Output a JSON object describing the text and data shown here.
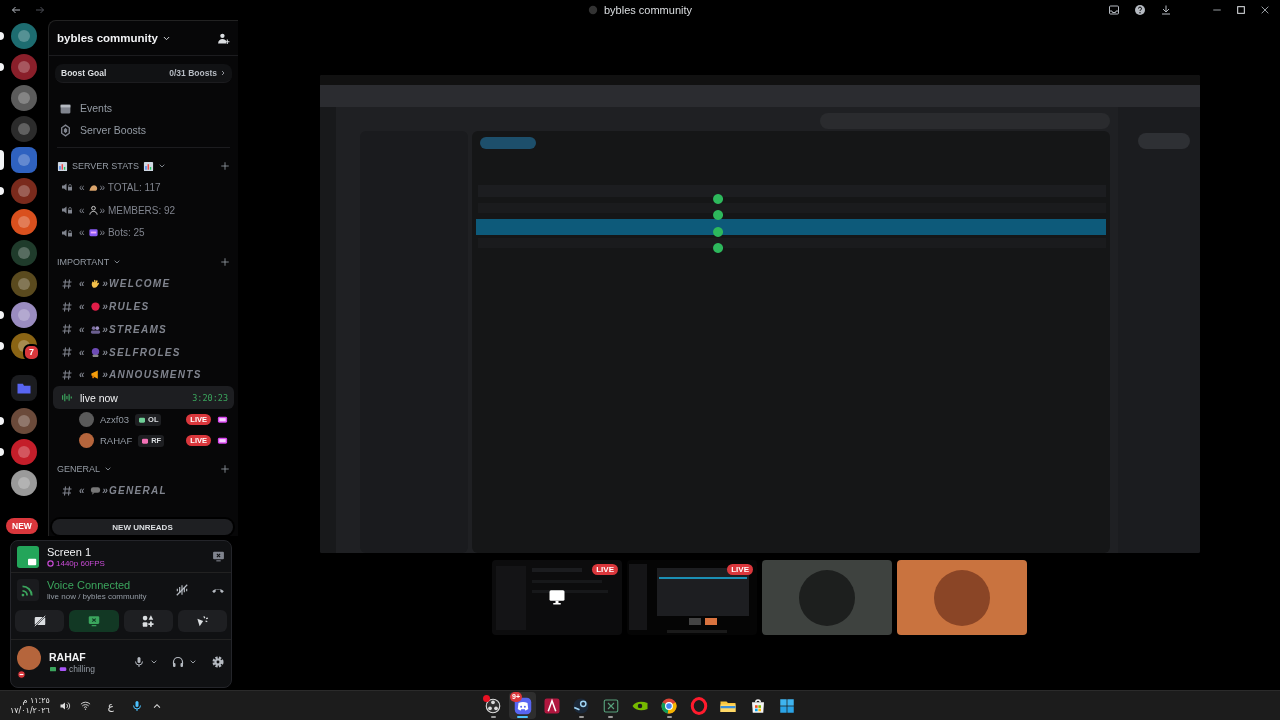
{
  "titlebar": {
    "title": "bybles community"
  },
  "servers": [
    {
      "kind": "server",
      "color": "#1d6c70",
      "unread": true,
      "selected": false
    },
    {
      "kind": "server",
      "color": "#8a1f2a",
      "unread": true,
      "selected": false
    },
    {
      "kind": "server",
      "color": "#5b5b5b",
      "unread": false,
      "selected": false
    },
    {
      "kind": "server",
      "color": "#2b2b2b",
      "unread": false,
      "selected": false
    },
    {
      "kind": "server",
      "color": "#2f62c0",
      "unread": false,
      "selected": true
    },
    {
      "kind": "server",
      "color": "#7a2a1c",
      "unread": true,
      "selected": false
    },
    {
      "kind": "server",
      "color": "#d9501e",
      "unread": false,
      "selected": false
    },
    {
      "kind": "server",
      "color": "#1f3b2b",
      "unread": false,
      "selected": false
    },
    {
      "kind": "server",
      "color": "#5a4a1e",
      "unread": false,
      "selected": false
    },
    {
      "kind": "server",
      "color": "#9a8cc0",
      "unread": true,
      "selected": false
    },
    {
      "kind": "server",
      "color": "#8a6414",
      "unread": true,
      "selected": false,
      "badge": "7"
    },
    {
      "kind": "folder",
      "color": "#5865f2",
      "unread": false,
      "selected": false
    },
    {
      "kind": "server",
      "color": "#6b4a3a",
      "unread": true,
      "selected": false
    },
    {
      "kind": "server",
      "color": "#c41e2a",
      "unread": true,
      "selected": false
    },
    {
      "kind": "server",
      "color": "#9a9a9a",
      "unread": false,
      "selected": false
    }
  ],
  "new_pill": "NEW",
  "guild": {
    "name": "bybles community",
    "boost": {
      "label": "Boost Goal",
      "count": "0/31 Boosts"
    },
    "links": [
      {
        "kind": "events",
        "label": "Events"
      },
      {
        "kind": "boosts",
        "label": "Server Boosts"
      }
    ]
  },
  "categories": [
    {
      "kind": "stats",
      "name": "SERVER STATS",
      "channels": [
        {
          "kind": "locked",
          "open": "«",
          "emoji": {
            "kind": "muscle"
          },
          "name": "» TOTAL: 117"
        },
        {
          "kind": "locked",
          "open": "«",
          "emoji": {
            "kind": "person"
          },
          "name": "» MEMBERS: 92"
        },
        {
          "kind": "locked",
          "open": "«",
          "emoji": {
            "kind": "bot"
          },
          "name": "» Bots: 25"
        }
      ]
    },
    {
      "kind": "plain",
      "name": "IMPORTANT",
      "channels": [
        {
          "kind": "text",
          "open": "«",
          "emoji": {
            "kind": "wave"
          },
          "name": "»WELCOME"
        },
        {
          "kind": "text",
          "open": "«",
          "emoji": {
            "kind": "dot"
          },
          "name": "»RULES"
        },
        {
          "kind": "text",
          "open": "«",
          "emoji": {
            "kind": "people"
          },
          "name": "»STREAMS"
        },
        {
          "kind": "text",
          "open": "«",
          "emoji": {
            "kind": "crystal"
          },
          "name": "»SELFROLES"
        },
        {
          "kind": "text",
          "open": "«",
          "emoji": {
            "kind": "megaphone"
          },
          "name": "»ANNOUSMENTS"
        },
        {
          "kind": "live",
          "name": "live now",
          "time": "3:20:23",
          "selected": true,
          "users": [
            {
              "name": "Azxf03",
              "tag": "OL",
              "color": "#6fcf97",
              "live": "LIVE"
            },
            {
              "name": "RAHAF",
              "tag": "RF",
              "color": "#f472b6",
              "live": "LIVE"
            }
          ]
        }
      ]
    },
    {
      "kind": "plain",
      "name": "GENERAL",
      "channels": [
        {
          "kind": "text",
          "open": "«",
          "emoji": {
            "kind": "speech"
          },
          "name": "»GENERAL"
        }
      ]
    }
  ],
  "new_unreads": "NEW UNREADS",
  "stream_panel": {
    "title": "Screen 1",
    "quality": "1440p 60FPS"
  },
  "voice": {
    "status": "Voice Connected",
    "location": "live now / bybles community"
  },
  "actions": [
    {
      "kind": "camera",
      "active": false
    },
    {
      "kind": "screen",
      "active": true
    },
    {
      "kind": "activities",
      "active": false
    },
    {
      "kind": "soundboard",
      "active": false
    }
  ],
  "user": {
    "name": "RAHAF",
    "status": "chilling"
  },
  "stage": {
    "tiles": [
      {
        "kind": "stream",
        "live": "LIVE",
        "monitor_icon": true
      },
      {
        "kind": "stream",
        "live": "LIVE",
        "monitor_icon": false
      },
      {
        "kind": "avatar",
        "color": "#3e423f"
      },
      {
        "kind": "avatar",
        "color": "#c9733f"
      }
    ]
  },
  "tray": {
    "time": "١١:٢٥ م",
    "date": "١٧/٠١/٢٠٢٦",
    "language": "ع"
  },
  "apps": [
    {
      "kind": "obs",
      "running": true,
      "active": false,
      "alert": true
    },
    {
      "kind": "discord",
      "running": true,
      "active": true,
      "badge": "9+"
    },
    {
      "kind": "affinity",
      "running": false,
      "active": false
    },
    {
      "kind": "steam",
      "running": true,
      "active": false
    },
    {
      "kind": "xbox",
      "running": true,
      "active": false
    },
    {
      "kind": "nvidia",
      "running": false,
      "active": false
    },
    {
      "kind": "chrome",
      "running": true,
      "active": false
    },
    {
      "kind": "opera",
      "running": false,
      "active": false
    },
    {
      "kind": "explorer",
      "running": false,
      "active": false
    },
    {
      "kind": "store",
      "running": false,
      "active": false
    },
    {
      "kind": "start",
      "running": false,
      "active": false
    }
  ]
}
